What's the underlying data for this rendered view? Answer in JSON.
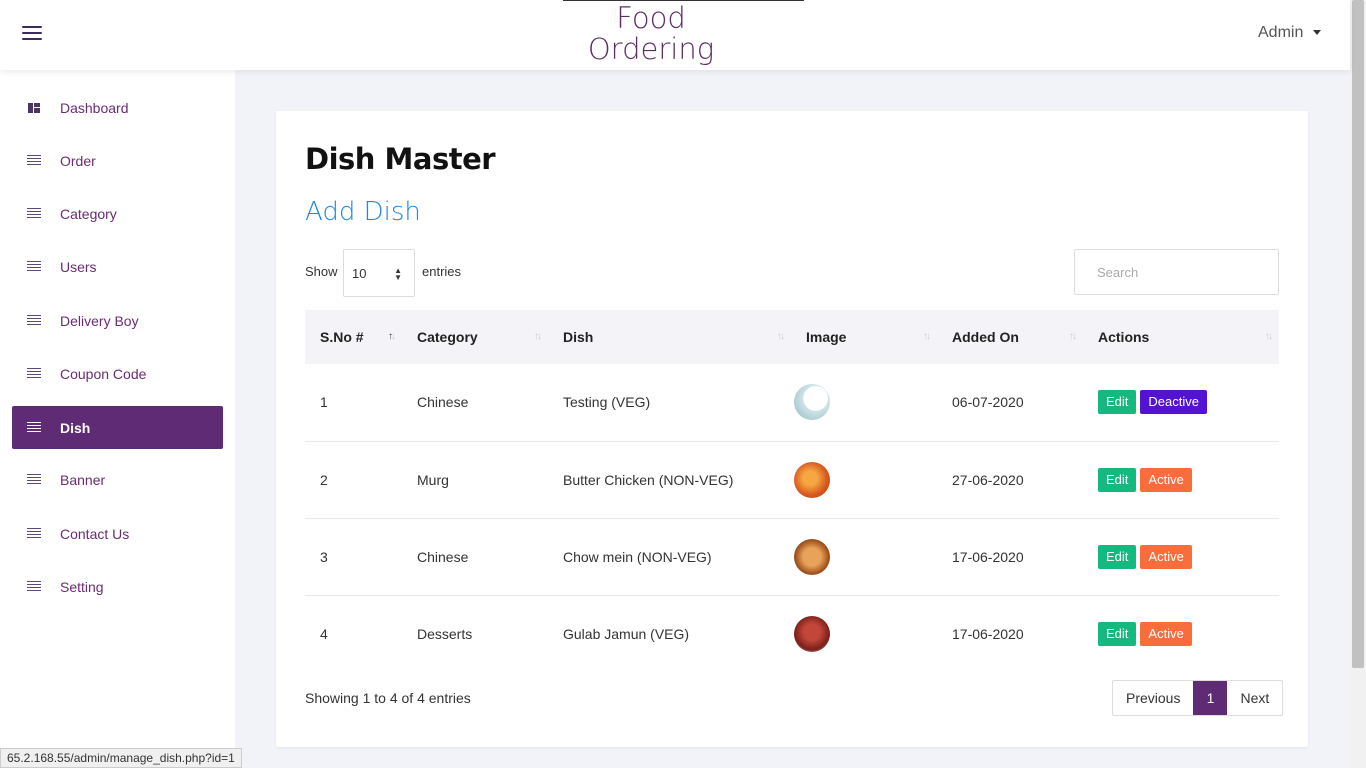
{
  "header": {
    "menu_icon": "hamburger-icon",
    "logo_line1": "Food",
    "logo_line2": "Ordering",
    "user_label": "Admin"
  },
  "sidebar": {
    "items": [
      {
        "label": "Dashboard",
        "icon": "dashboard-icon"
      },
      {
        "label": "Order",
        "icon": "list-icon"
      },
      {
        "label": "Category",
        "icon": "list-icon"
      },
      {
        "label": "Users",
        "icon": "list-icon"
      },
      {
        "label": "Delivery Boy",
        "icon": "list-icon"
      },
      {
        "label": "Coupon Code",
        "icon": "list-icon"
      },
      {
        "label": "Dish",
        "icon": "list-icon",
        "active": true
      },
      {
        "label": "Banner",
        "icon": "list-icon"
      },
      {
        "label": "Contact Us",
        "icon": "list-icon"
      },
      {
        "label": "Setting",
        "icon": "list-icon"
      }
    ],
    "active_color": "#5e2b74"
  },
  "main": {
    "title": "Dish Master",
    "add_link": "Add Dish",
    "show_label": "Show",
    "entries_value": "10",
    "entries_label": "entries",
    "search_placeholder": "Search",
    "columns": [
      "S.No #",
      "Category",
      "Dish",
      "Image",
      "Added On",
      "Actions"
    ],
    "rows": [
      {
        "sno": "1",
        "category": "Chinese",
        "dish": "Testing (VEG)",
        "added_on": "06-07-2020",
        "edit": "Edit",
        "status": "Deactive"
      },
      {
        "sno": "2",
        "category": "Murg",
        "dish": "Butter Chicken (NON-VEG)",
        "added_on": "27-06-2020",
        "edit": "Edit",
        "status": "Active"
      },
      {
        "sno": "3",
        "category": "Chinese",
        "dish": "Chow mein (NON-VEG)",
        "added_on": "17-06-2020",
        "edit": "Edit",
        "status": "Active"
      },
      {
        "sno": "4",
        "category": "Desserts",
        "dish": "Gulab Jamun (VEG)",
        "added_on": "17-06-2020",
        "edit": "Edit",
        "status": "Active"
      }
    ],
    "footer_info": "Showing 1 to 4 of 4 entries",
    "pagination": {
      "previous": "Previous",
      "current": "1",
      "next": "Next"
    }
  },
  "status_bar": "65.2.168.55/admin/manage_dish.php?id=1",
  "colors": {
    "edit": "#14b980",
    "deactive": "#5412d3",
    "active": "#f96d3d",
    "link": "#1e88e5"
  }
}
